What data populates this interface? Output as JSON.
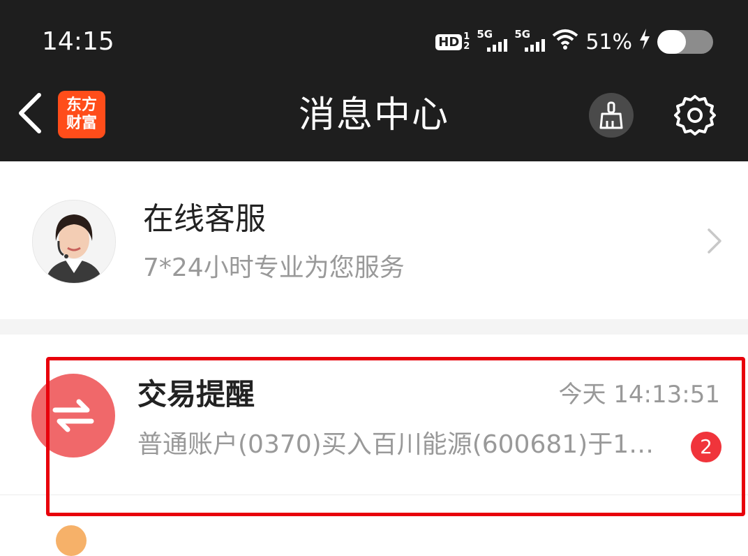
{
  "status_bar": {
    "time": "14:15",
    "hd_label": "HD",
    "hd_sup": "1",
    "hd_sub": "2",
    "signal1_label": "5G",
    "signal2_label": "5G",
    "battery_percent_text": "51%",
    "battery_level": 0.51,
    "charging_icon": "bolt-icon"
  },
  "nav": {
    "back_icon": "chevron-left-icon",
    "logo_line1": "东方",
    "logo_line2": "财富",
    "title": "消息中心",
    "clear_icon": "broom-icon",
    "settings_icon": "gear-icon"
  },
  "service": {
    "title": "在线客服",
    "subtitle": "7*24小时专业为您服务",
    "chevron_icon": "chevron-right-icon"
  },
  "trade": {
    "icon": "swap-arrows-icon",
    "title": "交易提醒",
    "time": "今天 14:13:51",
    "message": "普通账户(0370)买入百川能源(600681)于1…",
    "unread_count": "2"
  },
  "colors": {
    "header_bg": "#1e1e1e",
    "logo_bg": "#ff4d1a",
    "trade_icon_bg": "#f0686a",
    "badge_bg": "#f0343b",
    "highlight": "#e8000b"
  }
}
